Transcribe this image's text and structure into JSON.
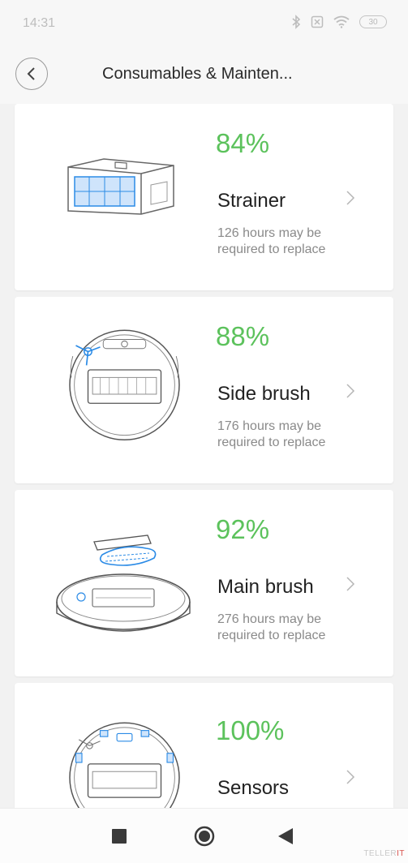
{
  "status_bar": {
    "time": "14:31",
    "battery": "30"
  },
  "header": {
    "title": "Consumables & Mainten..."
  },
  "items": [
    {
      "percent": "84%",
      "name": "Strainer",
      "description": "126 hours may be required to replace"
    },
    {
      "percent": "88%",
      "name": "Side brush",
      "description": "176 hours may be required to replace"
    },
    {
      "percent": "92%",
      "name": "Main brush",
      "description": "276 hours may be required to replace"
    },
    {
      "percent": "100%",
      "name": "Sensors",
      "description": ""
    }
  ],
  "watermark": {
    "text": "TELLER",
    "accent": "IT"
  },
  "colors": {
    "accent_green": "#5cc25c",
    "illustration_blue": "#2b8be6"
  },
  "icons": {
    "back": "chevron-left-icon",
    "row": "chevron-right-icon",
    "nav_recents": "square-icon",
    "nav_home": "circle-icon",
    "nav_back": "triangle-back-icon"
  }
}
